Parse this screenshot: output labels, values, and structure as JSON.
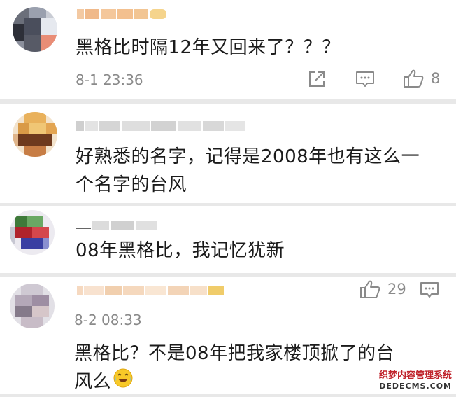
{
  "comments": [
    {
      "text": "黑格比时隔12年又回来了？？？",
      "time": "8-1 23:36",
      "like_count": "8"
    },
    {
      "text_line1": "好熟悉的名字，记得是2008年也有这么一",
      "text_line2": "个名字的台风"
    },
    {
      "text": "08年黑格比，我记忆犹新"
    },
    {
      "time": "8-2 08:33",
      "like_count": "29",
      "text_line1": "黑格比？不是08年把我家楼顶掀了的台",
      "text_line2": "风么"
    }
  ],
  "icons": {
    "share": "share-icon",
    "comment": "comment-icon",
    "like": "like-icon",
    "emoji": "laughing-crying-emoji-icon"
  },
  "watermark": {
    "line1": "织梦内容管理系统",
    "line2": "DEDECMS.COM"
  },
  "colors": {
    "background": "#e8e8e8",
    "card": "#ffffff",
    "text": "#1b1b1b",
    "meta": "#8a8a8a"
  }
}
